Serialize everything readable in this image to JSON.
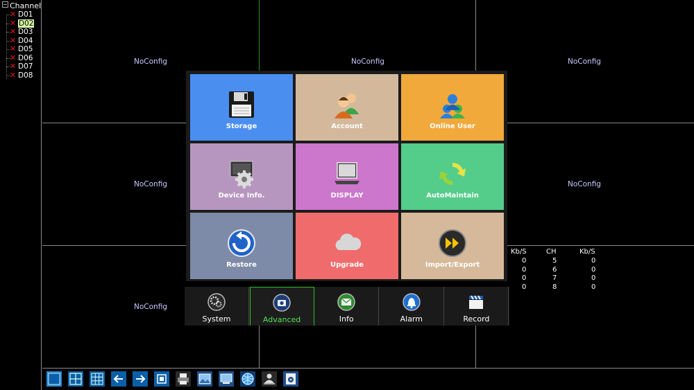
{
  "sidebar": {
    "title": "Channel",
    "channels": [
      {
        "label": "D01",
        "selected": false
      },
      {
        "label": "D02",
        "selected": true
      },
      {
        "label": "D03",
        "selected": false
      },
      {
        "label": "D04",
        "selected": false
      },
      {
        "label": "D05",
        "selected": false
      },
      {
        "label": "D06",
        "selected": false
      },
      {
        "label": "D07",
        "selected": false
      },
      {
        "label": "D08",
        "selected": false
      }
    ]
  },
  "video": {
    "cells": [
      "NoConfig",
      "NoConfig",
      "NoConfig",
      "NoConfig",
      "NoConfig",
      "NoConfig"
    ]
  },
  "stats": {
    "headers": [
      "Kb/S",
      "CH",
      "Kb/S"
    ],
    "rows": [
      [
        "0",
        "5",
        "0"
      ],
      [
        "0",
        "6",
        "0"
      ],
      [
        "0",
        "7",
        "0"
      ],
      [
        "0",
        "8",
        "0"
      ]
    ]
  },
  "menu": {
    "tiles": [
      {
        "label": "Storage",
        "color": "#4a8ef0",
        "icon": "floppy-disk-icon"
      },
      {
        "label": "Account",
        "color": "#d3b89c",
        "icon": "users-icon"
      },
      {
        "label": "Online User",
        "color": "#f2a93b",
        "icon": "online-users-icon"
      },
      {
        "label": "Device Info.",
        "color": "#b696bf",
        "icon": "device-gear-icon"
      },
      {
        "label": "DISPLAY",
        "color": "#cc76cc",
        "icon": "laptop-icon"
      },
      {
        "label": "AutoMaintain",
        "color": "#54cc8a",
        "icon": "recycle-icon"
      },
      {
        "label": "Restore",
        "color": "#7d8aa8",
        "icon": "restore-icon"
      },
      {
        "label": "Upgrade",
        "color": "#f06c6c",
        "icon": "cloud-icon"
      },
      {
        "label": "Import/Export",
        "color": "#d6b99a",
        "icon": "fast-forward-icon"
      }
    ]
  },
  "tabs": [
    {
      "label": "System",
      "icon": "gears-icon",
      "active": false
    },
    {
      "label": "Advanced",
      "icon": "camera-icon",
      "active": true
    },
    {
      "label": "Info",
      "icon": "mail-icon",
      "active": false
    },
    {
      "label": "Alarm",
      "icon": "bell-icon",
      "active": false
    },
    {
      "label": "Record",
      "icon": "clapperboard-icon",
      "active": false
    }
  ],
  "taskbar": {
    "buttons": [
      "single-view-icon",
      "quad-view-icon",
      "nine-view-icon",
      "previous-icon",
      "next-icon",
      "fullscreen-icon",
      "printer-icon",
      "image-icon",
      "monitor-icon",
      "network-icon",
      "user-icon",
      "disk-icon"
    ]
  }
}
